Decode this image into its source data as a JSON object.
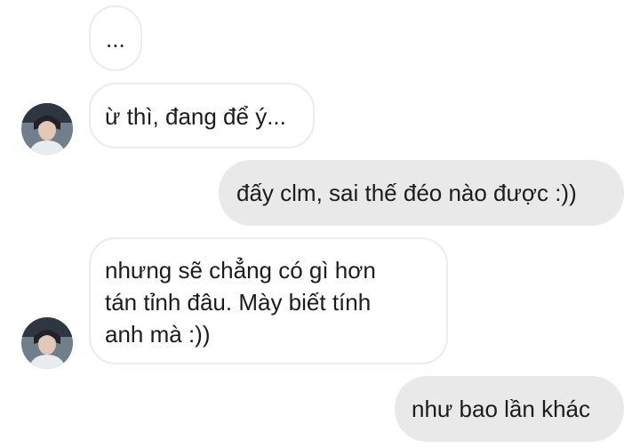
{
  "messages": [
    {
      "id": "m1",
      "direction": "incoming",
      "lines": [
        "..."
      ]
    },
    {
      "id": "m2",
      "direction": "incoming",
      "lines": [
        "ừ thì, đang để ý..."
      ]
    },
    {
      "id": "m3",
      "direction": "outgoing",
      "lines": [
        "đấy clm, sai thế đéo nào được :))"
      ]
    },
    {
      "id": "m4",
      "direction": "incoming",
      "lines": [
        "nhưng sẽ chẳng có gì hơn",
        "tán tỉnh đâu. Mày biết tính",
        "anh mà :))"
      ]
    },
    {
      "id": "m5",
      "direction": "outgoing",
      "lines": [
        "như bao lần khác"
      ]
    }
  ],
  "colors": {
    "outgoing_bubble": "#e9e9ea",
    "incoming_border": "#ececec",
    "text": "#1c1c1c"
  },
  "avatar_icon": "profile-photo-icon"
}
